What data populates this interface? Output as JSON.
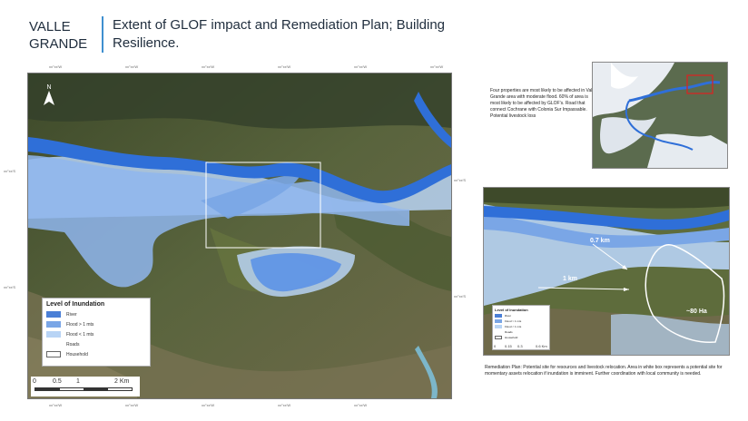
{
  "header": {
    "place": "VALLE GRANDE",
    "title": "Extent of GLOF impact and Remediation Plan; Building Resilience."
  },
  "main_map": {
    "coords_top": [
      "xx°xx'W",
      "xx°xx'W",
      "xx°xx'W",
      "xx°xx'W",
      "xx°xx'W",
      "xx°xx'W"
    ],
    "coords_left": [
      "xx°xx'S",
      "xx°xx'S"
    ],
    "coords_right": [
      "xx°xx'S",
      "xx°xx'S"
    ],
    "legend": {
      "title": "Level of Inundation",
      "items": [
        {
          "label": "River",
          "color": "#4a7fd6"
        },
        {
          "label": "Flood > 1 mts",
          "color": "#7aa6e6"
        },
        {
          "label": "Flood < 1 mts",
          "color": "#b8d4f5"
        },
        {
          "label": "Roads",
          "color": "#ffffff"
        },
        {
          "label": "Household",
          "color": "#ffffff"
        }
      ]
    },
    "scale": {
      "labels": [
        "0",
        "0.5",
        "1",
        "2 Km"
      ]
    }
  },
  "side_text": "Four properties are most likely to be affected in Valle Grande area with moderate flood. 60% of area is most likely to be affected by GLOF's. Road that connect Cochrane with Colonia Sur Impassable. Potential livestock loss",
  "detail_inset": {
    "dist_1": "0.7 km",
    "dist_2": "1 km",
    "area": "~80 Ha",
    "legend_title": "Level of Inundation",
    "legend_items": [
      "River",
      "Flood > 1 mts",
      "Flood < 1 mts",
      "Roads",
      "Household"
    ],
    "scale_labels": [
      "0",
      "0.15",
      "0.3",
      "0.6 Km"
    ]
  },
  "remediation": "Remediation Plan: Potential site for resources and livestock relocation. Area in white box represents a potential site for momentary assets relocation if inundation is imminent. Further coordination with local community is needed.",
  "colors": {
    "accent": "#3f8fcf",
    "river": "#2f6fd8",
    "flood_deep": "#7aa6e6",
    "flood_shallow": "#b8d4f5",
    "vegetation": "#4d5a34"
  }
}
